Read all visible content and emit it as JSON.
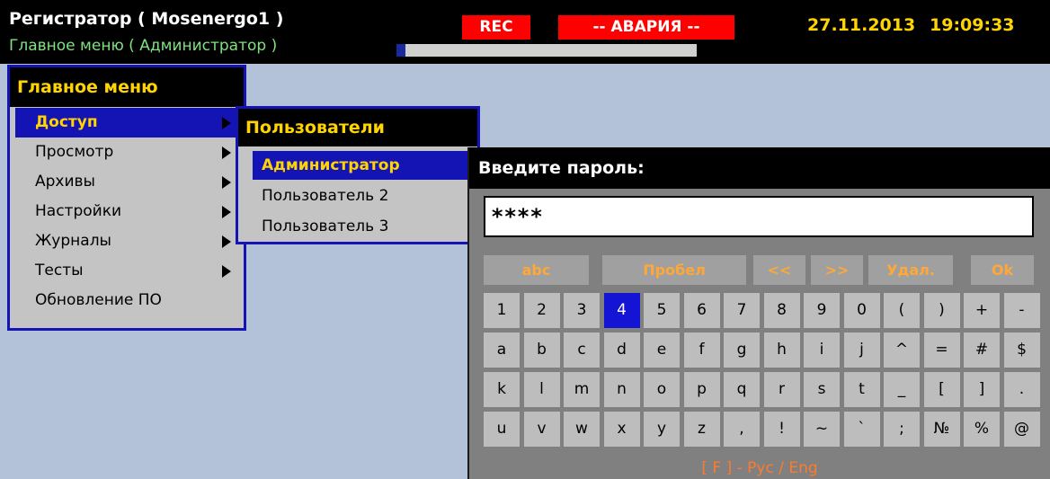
{
  "header": {
    "title": "Регистратор ( Mosenergo1 )",
    "subtitle": "Главное меню ( Администратор )",
    "rec_label": "REC",
    "alarm_label": "-- АВАРИЯ --",
    "date": "27.11.2013",
    "time": "19:09:33",
    "progress_fraction": 0.03
  },
  "main_menu": {
    "title": "Главное меню",
    "items": [
      {
        "label": "Доступ",
        "submenu": true,
        "active": true
      },
      {
        "label": "Просмотр",
        "submenu": true
      },
      {
        "label": "Архивы",
        "submenu": true
      },
      {
        "label": "Настройки",
        "submenu": true
      },
      {
        "label": "Журналы",
        "submenu": true
      },
      {
        "label": "Тесты",
        "submenu": true
      },
      {
        "label": "Обновление ПО",
        "submenu": false
      }
    ]
  },
  "users_menu": {
    "title": "Пользователи",
    "items": [
      {
        "label": "Администратор",
        "active": true
      },
      {
        "label": "Пользователь 2"
      },
      {
        "label": "Пользователь 3"
      }
    ]
  },
  "password_dialog": {
    "title": "Введите пароль:",
    "value": "****",
    "func_keys": [
      "abc",
      "Пробел",
      "<<",
      ">>",
      "Удал.",
      "Ok"
    ],
    "keyboard_rows": [
      [
        "1",
        "2",
        "3",
        "4",
        "5",
        "6",
        "7",
        "8",
        "9",
        "0",
        "(",
        ")",
        "+",
        "-"
      ],
      [
        "a",
        "b",
        "c",
        "d",
        "e",
        "f",
        "g",
        "h",
        "i",
        "j",
        "^",
        "=",
        "#",
        "$"
      ],
      [
        "k",
        "l",
        "m",
        "n",
        "o",
        "p",
        "q",
        "r",
        "s",
        "t",
        "_",
        "[",
        "]",
        "."
      ],
      [
        "u",
        "v",
        "w",
        "x",
        "y",
        "z",
        ",",
        "!",
        "~",
        "`",
        ";",
        "№",
        "%",
        "@"
      ]
    ],
    "active_key": "4",
    "footer": "[ F ] - Рус / Eng"
  },
  "colors": {
    "accent_blue": "#1414b4",
    "highlight_yellow": "#ffd400",
    "alarm_red": "#ff0000",
    "orange_text": "#ff7a2a"
  }
}
